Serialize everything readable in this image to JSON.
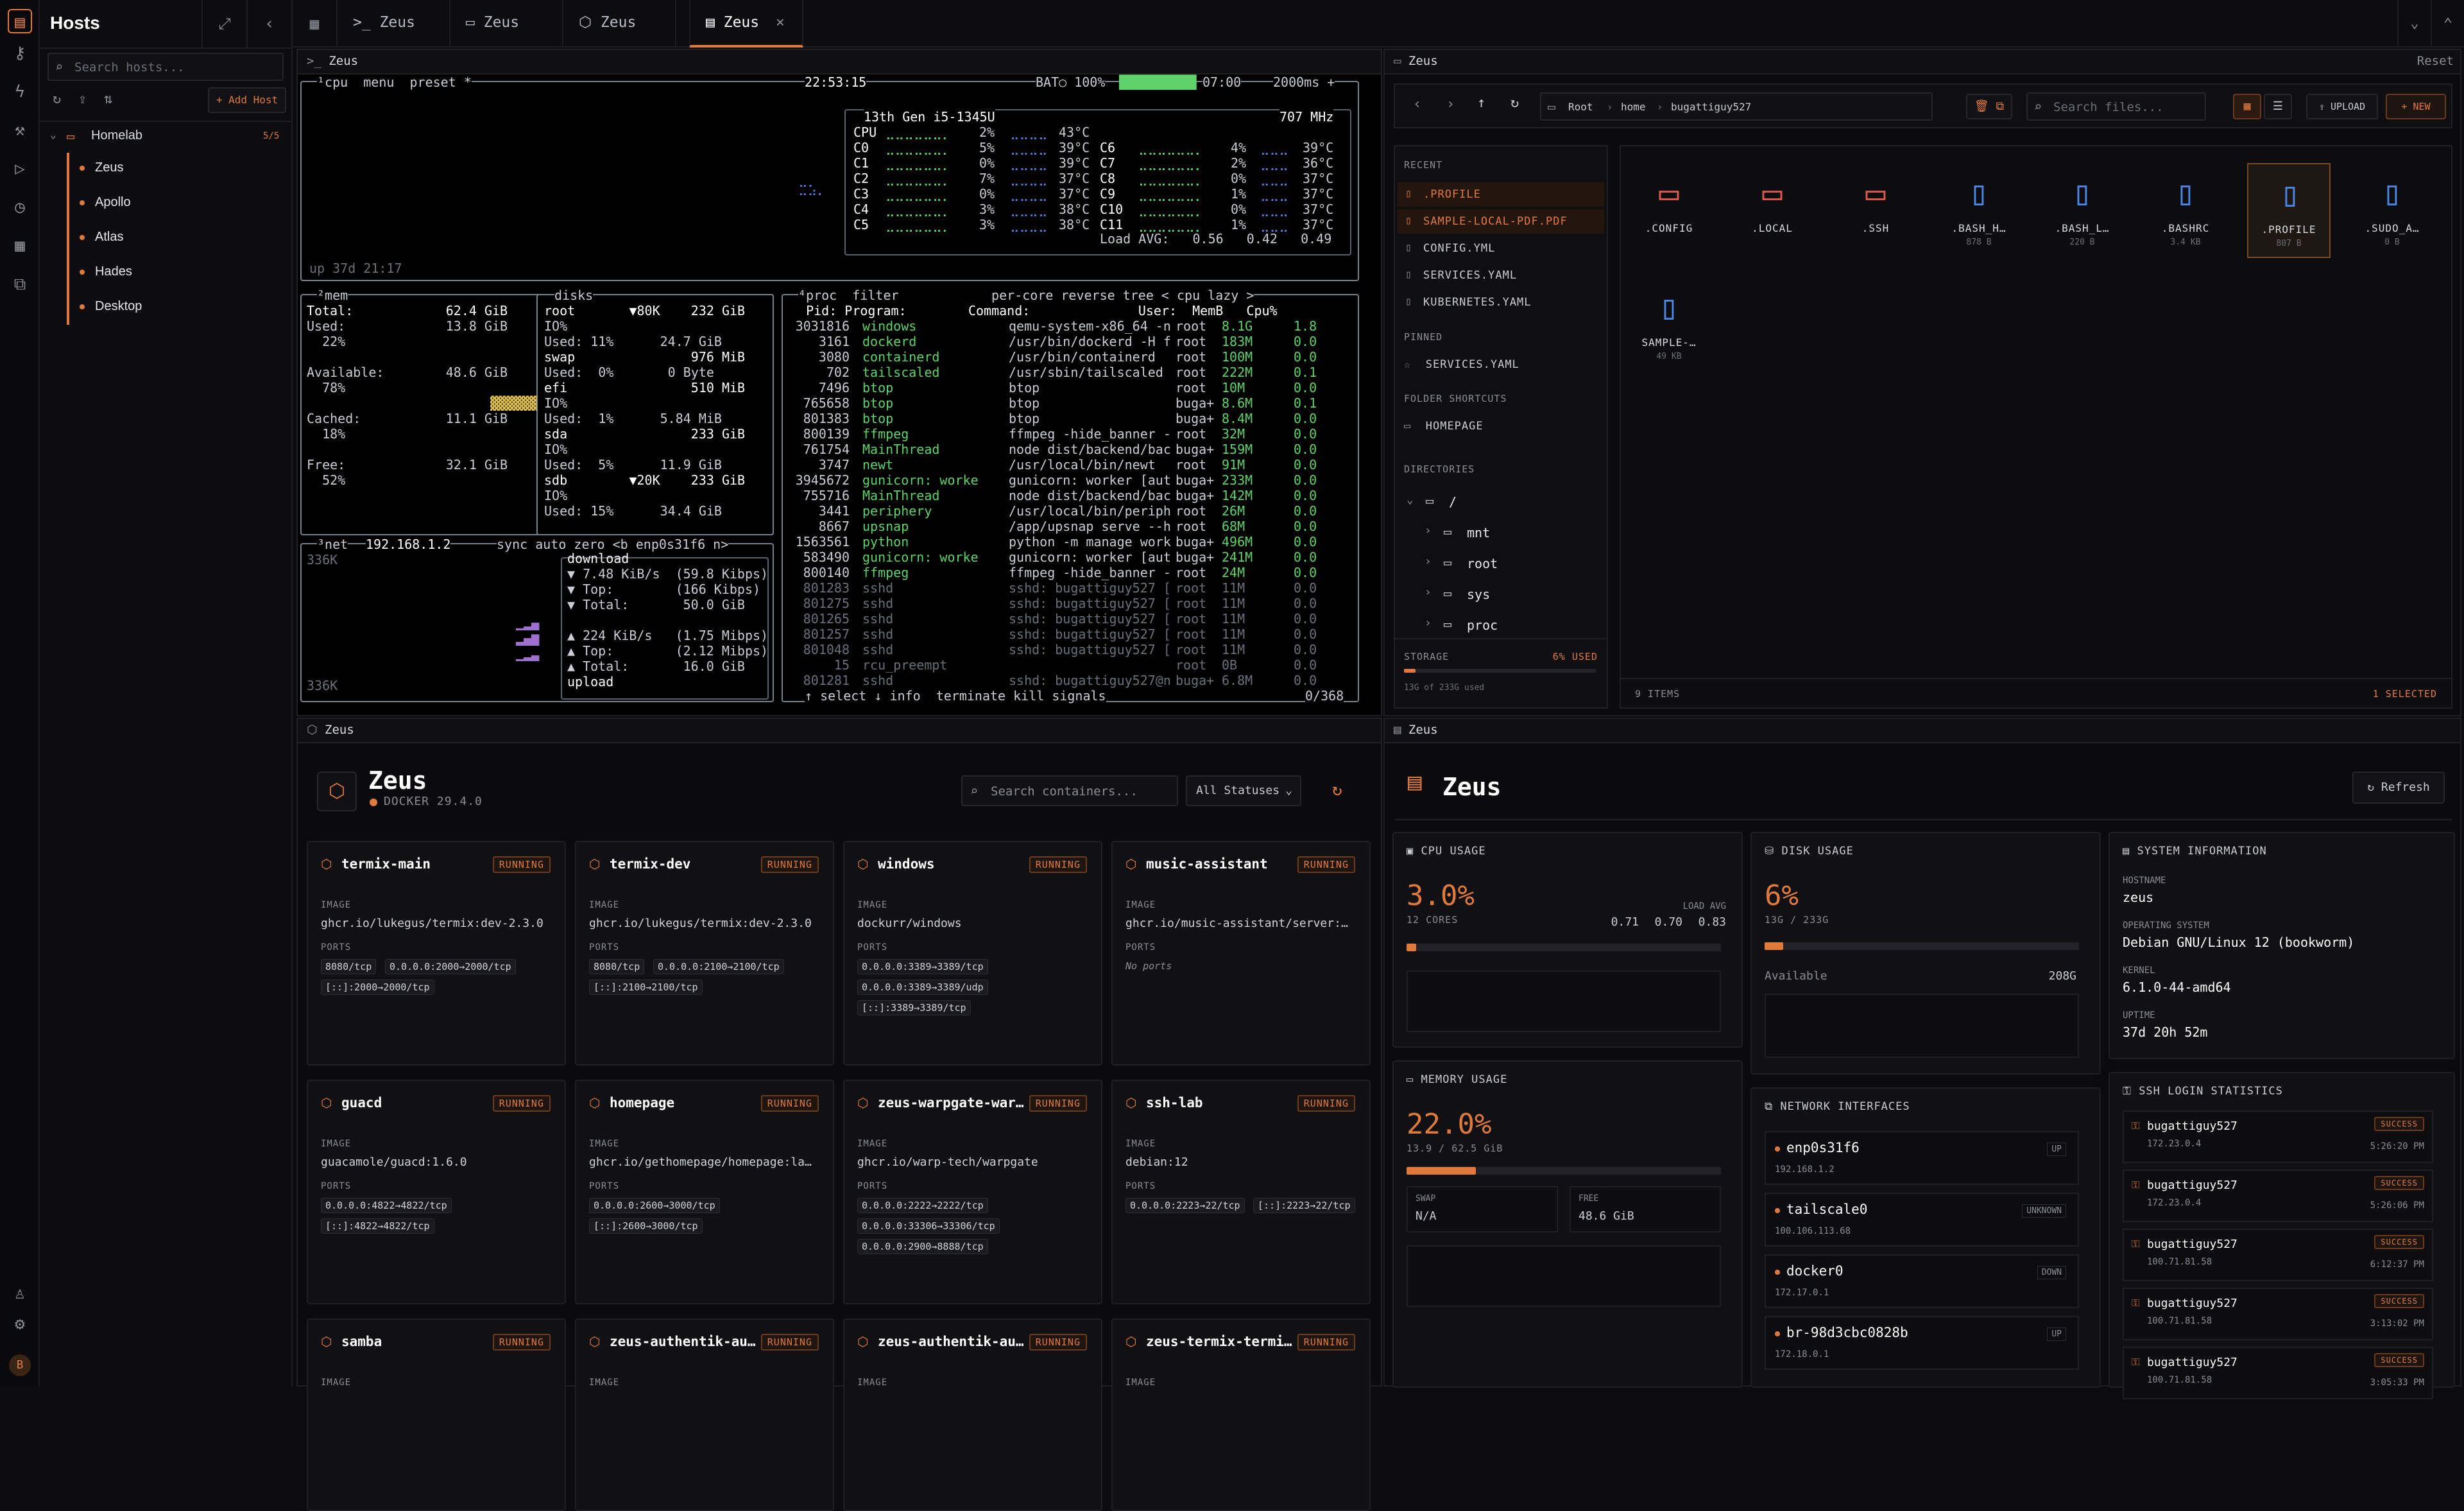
{
  "rail": {
    "icons": [
      "terminal-icon",
      "key-icon",
      "bolt-icon",
      "hammer-icon",
      "play-icon",
      "clock-icon",
      "grid-icon",
      "network-icon",
      "user-icon",
      "gear-icon"
    ],
    "avatar": "B"
  },
  "hosts": {
    "title": "Hosts",
    "search_placeholder": "Search hosts...",
    "add_label": "+ Add Host",
    "folder": "Homelab",
    "folder_count": "5/5",
    "items": [
      "Zeus",
      "Apollo",
      "Atlas",
      "Hades",
      "Desktop"
    ]
  },
  "tabs": [
    {
      "icon": ">_",
      "label": "Zeus"
    },
    {
      "icon": "▭",
      "label": "Zeus"
    },
    {
      "icon": "⬡",
      "label": "Zeus"
    },
    {
      "icon": "▤",
      "label": "Zeus",
      "active": true
    }
  ],
  "terminal": {
    "title": "Zeus",
    "cpu_header": "¹cpu  menu  preset *",
    "clock": "22:53:15",
    "battery": "BAT○ 100%",
    "bat_time": "07:00",
    "interval": "2000ms +",
    "cpu_model": "13th Gen i5-1345U",
    "freq": "707 MHz",
    "cores": [
      [
        "CPU",
        "2%",
        "43°C"
      ],
      [
        "C0",
        "5%",
        "39°C"
      ],
      [
        "C1",
        "0%",
        "39°C"
      ],
      [
        "C2",
        "7%",
        "37°C"
      ],
      [
        "C3",
        "0%",
        "37°C"
      ],
      [
        "C4",
        "3%",
        "38°C"
      ],
      [
        "C5",
        "3%",
        "38°C"
      ]
    ],
    "cores2": [
      [
        "C6",
        "4%",
        "39°C"
      ],
      [
        "C7",
        "2%",
        "36°C"
      ],
      [
        "C8",
        "0%",
        "37°C"
      ],
      [
        "C9",
        "1%",
        "37°C"
      ],
      [
        "C10",
        "0%",
        "37°C"
      ],
      [
        "C11",
        "1%",
        "37°C"
      ]
    ],
    "load": "Load AVG:   0.56   0.42   0.49",
    "uptime": "up 37d 21:17",
    "mem": {
      "title": "²mem",
      "total": "Total:            62.4 GiB",
      "used": "Used:             13.8 GiB",
      "used_pct": "  22%",
      "avail": "Available:        48.6 GiB",
      "avail_pct": "  78%",
      "cached": "Cached:           11.1 GiB",
      "cached_pct": "  18%",
      "free": "Free:             32.1 GiB",
      "free_pct": "  52%"
    },
    "disks": {
      "title": "disks",
      "lines": [
        "root       ▼80K    232 GiB",
        "IO%",
        "Used: 11%      24.7 GiB",
        "swap               976 MiB",
        "Used:  0%       0 Byte",
        "efi                510 MiB",
        "IO%",
        "Used:  1%      5.84 MiB",
        "sda                233 GiB",
        "IO%",
        "Used:  5%      11.9 GiB",
        "sdb        ▼20K    233 GiB",
        "IO%",
        "Used: 15%      34.4 GiB"
      ]
    },
    "net": {
      "title": "³net",
      "ip": "192.168.1.2",
      "flags": "sync auto zero <b enp0s31f6 n>",
      "scale_top": "336K",
      "scale_bot": "336K",
      "lines": [
        "download",
        "▼ 7.48 KiB/s  (59.8 Kibps)",
        "▼ Top:        (166 Kibps)",
        "▼ Total:       50.0 GiB",
        "",
        "▲ 224 KiB/s   (1.75 Mibps)",
        "▲ Top:        (2.12 Mibps)",
        "▲ Total:       16.0 GiB",
        "upload"
      ]
    },
    "proc": {
      "title": "⁴proc  filter            per-core reverse tree < cpu lazy >",
      "header": "  Pid: Program:        Command:              User:  MemB   Cpu%",
      "rows": [
        [
          "3031816",
          "windows",
          "qemu-system-x86_64 -n",
          "root",
          "8.1G",
          "1.8"
        ],
        [
          "3161",
          "dockerd",
          "/usr/bin/dockerd -H f",
          "root",
          "183M",
          "0.0"
        ],
        [
          "3080",
          "containerd",
          "/usr/bin/containerd",
          "root",
          "100M",
          "0.0"
        ],
        [
          "702",
          "tailscaled",
          "/usr/sbin/tailscaled",
          "root",
          "222M",
          "0.1"
        ],
        [
          "7496",
          "btop",
          "btop",
          "root",
          "10M",
          "0.0"
        ],
        [
          "765658",
          "btop",
          "btop",
          "buga+",
          "8.6M",
          "0.1"
        ],
        [
          "801383",
          "btop",
          "btop",
          "buga+",
          "8.4M",
          "0.0"
        ],
        [
          "800139",
          "ffmpeg",
          "ffmpeg -hide_banner -",
          "root",
          "32M",
          "0.0"
        ],
        [
          "761754",
          "MainThread",
          "node dist/backend/bac",
          "buga+",
          "159M",
          "0.0"
        ],
        [
          "3747",
          "newt",
          "/usr/local/bin/newt",
          "root",
          "91M",
          "0.0"
        ],
        [
          "3945672",
          "gunicorn: worke",
          "gunicorn: worker [aut",
          "buga+",
          "233M",
          "0.0"
        ],
        [
          "755716",
          "MainThread",
          "node dist/backend/bac",
          "buga+",
          "142M",
          "0.0"
        ],
        [
          "3441",
          "periphery",
          "/usr/local/bin/periph",
          "root",
          "26M",
          "0.0"
        ],
        [
          "8667",
          "upsnap",
          "/app/upsnap serve --h",
          "root",
          "68M",
          "0.0"
        ],
        [
          "1563561",
          "python",
          "python -m manage work",
          "buga+",
          "496M",
          "0.0"
        ],
        [
          "583490",
          "gunicorn: worke",
          "gunicorn: worker [aut",
          "buga+",
          "241M",
          "0.0"
        ],
        [
          "800140",
          "ffmpeg",
          "ffmpeg -hide_banner -",
          "root",
          "24M",
          "0.0"
        ],
        [
          "801283",
          "sshd",
          "sshd: bugattiguy527 [",
          "root",
          "11M",
          "0.0"
        ],
        [
          "801275",
          "sshd",
          "sshd: bugattiguy527 [",
          "root",
          "11M",
          "0.0"
        ],
        [
          "801265",
          "sshd",
          "sshd: bugattiguy527 [",
          "root",
          "11M",
          "0.0"
        ],
        [
          "801257",
          "sshd",
          "sshd: bugattiguy527 [",
          "root",
          "11M",
          "0.0"
        ],
        [
          "801048",
          "sshd",
          "sshd: bugattiguy527 [",
          "root",
          "11M",
          "0.0"
        ],
        [
          "15",
          "rcu_preempt",
          "",
          "root",
          "0B",
          "0.0"
        ],
        [
          "801281",
          "sshd",
          "sshd: bugattiguy527@n",
          "buga+",
          "6.8M",
          "0.0"
        ]
      ],
      "footer": "↑ select ↓ info  terminate kill signals",
      "count": "0/368"
    }
  },
  "files": {
    "title": "Zeus",
    "reset": "Reset",
    "breadcrumb": [
      "Root",
      "home",
      "bugattiguy527"
    ],
    "search_placeholder": "Search files...",
    "upload": "UPLOAD",
    "new": "+ NEW",
    "recent_label": "RECENT",
    "recent": [
      ".PROFILE",
      "SAMPLE-LOCAL-PDF.PDF",
      "CONFIG.YML",
      "SERVICES.YAML",
      "KUBERNETES.YAML"
    ],
    "pinned_label": "PINNED",
    "pinned": [
      "SERVICES.YAML"
    ],
    "shortcuts_label": "FOLDER SHORTCUTS",
    "shortcuts": [
      "HOMEPAGE"
    ],
    "dirs_label": "DIRECTORIES",
    "dirs": [
      "/",
      "mnt",
      "root",
      "sys",
      "proc"
    ],
    "storage_label": "STORAGE",
    "storage_used": "6% USED",
    "storage_detail": "13G of 233G used",
    "storage_fraction": 0.06,
    "items": [
      {
        "name": ".CONFIG",
        "size": "",
        "type": "folder"
      },
      {
        "name": ".LOCAL",
        "size": "",
        "type": "folder"
      },
      {
        "name": ".SSH",
        "size": "",
        "type": "folder"
      },
      {
        "name": ".BASH_H…",
        "size": "878 B",
        "type": "file"
      },
      {
        "name": ".BASH_L…",
        "size": "220 B",
        "type": "file"
      },
      {
        "name": ".BASHRC",
        "size": "3.4 KB",
        "type": "file"
      },
      {
        "name": ".PROFILE",
        "size": "807 B",
        "type": "file",
        "selected": true
      },
      {
        "name": ".SUDO_A…",
        "size": "0 B",
        "type": "file"
      },
      {
        "name": "SAMPLE-…",
        "size": "49 KB",
        "type": "file"
      }
    ],
    "status_items": "9 ITEMS",
    "status_selected": "1 SELECTED"
  },
  "docker": {
    "title": "Zeus",
    "name": "Zeus",
    "version": "DOCKER 29.4.0",
    "search_placeholder": "Search containers...",
    "filter": "All Statuses",
    "image_label": "IMAGE",
    "ports_label": "PORTS",
    "containers": [
      {
        "name": "termix-main",
        "status": "RUNNING",
        "image": "ghcr.io/lukegus/termix:dev-2.3.0",
        "ports": [
          "8080/tcp",
          "0.0.0.0:2000→2000/tcp",
          "[::]:2000→2000/tcp"
        ]
      },
      {
        "name": "termix-dev",
        "status": "RUNNING",
        "image": "ghcr.io/lukegus/termix:dev-2.3.0",
        "ports": [
          "8080/tcp",
          "0.0.0.0:2100→2100/tcp",
          "[::]:2100→2100/tcp"
        ]
      },
      {
        "name": "windows",
        "status": "RUNNING",
        "image": "dockurr/windows",
        "ports": [
          "0.0.0.0:3389→3389/tcp",
          "0.0.0.0:3389→3389/udp",
          "[::]:3389→3389/tcp"
        ]
      },
      {
        "name": "music-assistant",
        "status": "RUNNING",
        "image": "ghcr.io/music-assistant/server:…",
        "ports": [],
        "no_ports": "No ports"
      },
      {
        "name": "guacd",
        "status": "RUNNING",
        "image": "guacamole/guacd:1.6.0",
        "ports": [
          "0.0.0.0:4822→4822/tcp",
          "[::]:4822→4822/tcp"
        ]
      },
      {
        "name": "homepage",
        "status": "RUNNING",
        "image": "ghcr.io/gethomepage/homepage:la…",
        "ports": [
          "0.0.0.0:2600→3000/tcp",
          "[::]:2600→3000/tcp"
        ]
      },
      {
        "name": "zeus-warpgate-war…",
        "status": "RUNNING",
        "image": "ghcr.io/warp-tech/warpgate",
        "ports": [
          "0.0.0.0:2222→2222/tcp",
          "0.0.0.0:33306→33306/tcp",
          "0.0.0.0:2900→8888/tcp"
        ]
      },
      {
        "name": "ssh-lab",
        "status": "RUNNING",
        "image": "debian:12",
        "ports": [
          "0.0.0.0:2223→22/tcp",
          "[::]:2223→22/tcp"
        ]
      },
      {
        "name": "samba",
        "status": "RUNNING",
        "image": "",
        "ports": []
      },
      {
        "name": "zeus-authentik-au…",
        "status": "RUNNING",
        "image": "",
        "ports": []
      },
      {
        "name": "zeus-authentik-au…",
        "status": "RUNNING",
        "image": "",
        "ports": []
      },
      {
        "name": "zeus-termix-termi…",
        "status": "RUNNING",
        "image": "",
        "ports": []
      }
    ]
  },
  "stats": {
    "title": "Zeus",
    "name": "Zeus",
    "refresh": "Refresh",
    "cpu": {
      "label": "CPU USAGE",
      "value": "3.0%",
      "cores": "12 CORES",
      "load_label": "LOAD AVG",
      "load": [
        "0.71",
        "0.70",
        "0.83"
      ],
      "fraction": 0.03
    },
    "disk": {
      "label": "DISK USAGE",
      "value": "6%",
      "detail": "13G / 233G",
      "avail_label": "Available",
      "avail": "208G",
      "fraction": 0.06
    },
    "mem": {
      "label": "MEMORY USAGE",
      "value": "22.0%",
      "detail": "13.9 / 62.5 GiB",
      "swap_label": "SWAP",
      "swap": "N/A",
      "free_label": "FREE",
      "free": "48.6 GiB",
      "fraction": 0.22
    },
    "sys": {
      "label": "SYSTEM INFORMATION",
      "hostname_label": "HOSTNAME",
      "hostname": "zeus",
      "os_label": "OPERATING SYSTEM",
      "os": "Debian GNU/Linux 12 (bookworm)",
      "kernel_label": "KERNEL",
      "kernel": "6.1.0-44-amd64",
      "uptime_label": "UPTIME",
      "uptime": "37d 20h 52m"
    },
    "net": {
      "label": "NETWORK INTERFACES",
      "ifaces": [
        {
          "name": "enp0s31f6",
          "ip": "192.168.1.2",
          "state": "UP"
        },
        {
          "name": "tailscale0",
          "ip": "100.106.113.68",
          "state": "UNKNOWN"
        },
        {
          "name": "docker0",
          "ip": "172.17.0.1",
          "state": "DOWN"
        },
        {
          "name": "br-98d3cbc0828b",
          "ip": "172.18.0.1",
          "state": "UP"
        }
      ]
    },
    "ssh": {
      "label": "SSH LOGIN STATISTICS",
      "logins": [
        {
          "user": "bugattiguy527",
          "ip": "172.23.0.4",
          "status": "SUCCESS",
          "time": "5:26:20 PM"
        },
        {
          "user": "bugattiguy527",
          "ip": "172.23.0.4",
          "status": "SUCCESS",
          "time": "5:26:06 PM"
        },
        {
          "user": "bugattiguy527",
          "ip": "100.71.81.58",
          "status": "SUCCESS",
          "time": "6:12:37 PM"
        },
        {
          "user": "bugattiguy527",
          "ip": "100.71.81.58",
          "status": "SUCCESS",
          "time": "3:13:02 PM"
        },
        {
          "user": "bugattiguy527",
          "ip": "100.71.81.58",
          "status": "SUCCESS",
          "time": "3:05:33 PM"
        }
      ]
    }
  }
}
